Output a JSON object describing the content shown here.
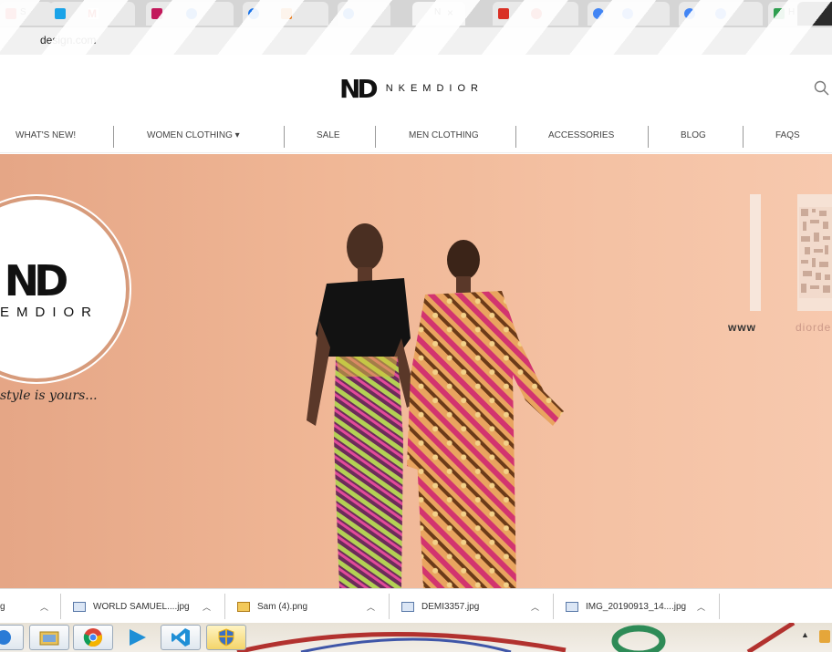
{
  "browser": {
    "url": "design.com",
    "tabs": [
      {
        "short": "S",
        "color": "#e8453c"
      },
      {
        "short": "",
        "color": "#1aa3e8"
      },
      {
        "short": "M",
        "color": "#d93025"
      },
      {
        "short": "",
        "color": "#c2185b"
      },
      {
        "short": "",
        "color": "#1a73e8"
      },
      {
        "short": "",
        "color": "#1a73e8"
      },
      {
        "short": "",
        "color": "#e8710a"
      },
      {
        "short": "",
        "color": "#1a73e8"
      },
      {
        "short": "",
        "color": "#1a73e8"
      },
      {
        "short": "N",
        "color": "#888888"
      },
      {
        "short": "",
        "color": "#d93025"
      },
      {
        "short": "",
        "color": "#d93025"
      },
      {
        "short": "",
        "color": "#4285f4"
      },
      {
        "short": "",
        "color": "#4285f4"
      },
      {
        "short": "",
        "color": "#4285f4"
      },
      {
        "short": "",
        "color": "#4285f4"
      },
      {
        "short": "H",
        "color": "#2e9e4f"
      }
    ],
    "active_tab_close": "×"
  },
  "site": {
    "brand_mono": "ND",
    "brand_word": "NKEMDIOR",
    "nav": [
      {
        "label": "WHAT'S NEW!"
      },
      {
        "label": "WOMEN CLOTHING ▾"
      },
      {
        "label": "SALE"
      },
      {
        "label": "MEN CLOTHING"
      },
      {
        "label": "ACCESSORIES"
      },
      {
        "label": "BLOG"
      },
      {
        "label": "FAQS"
      }
    ],
    "hero": {
      "mono": "ND",
      "word": "EMDIOR",
      "tagline": "style is yours...",
      "www": "www",
      "domain": "diorde"
    }
  },
  "downloads": [
    {
      "name": "g",
      "icon": "image-file-icon"
    },
    {
      "name": "WORLD SAMUEL....jpg",
      "icon": "image-file-icon"
    },
    {
      "name": "Sam (4).png",
      "icon": "png-file-icon"
    },
    {
      "name": "DEMI3357.jpg",
      "icon": "image-file-icon"
    },
    {
      "name": "IMG_20190913_14....jpg",
      "icon": "image-file-icon"
    }
  ],
  "colors": {
    "hero_bg": "#f0b796",
    "accent_ring": "#d79b7b"
  }
}
